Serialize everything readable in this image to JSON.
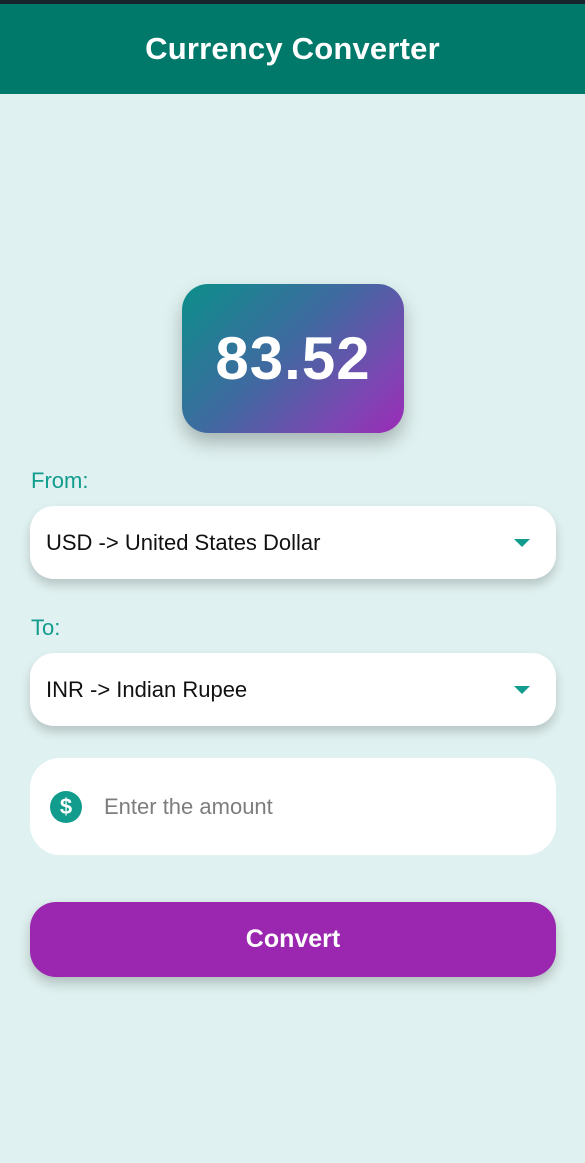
{
  "app_bar": {
    "title": "Currency Converter"
  },
  "result": {
    "value": "83.52"
  },
  "from": {
    "label": "From:",
    "selected": "USD -> United States Dollar"
  },
  "to": {
    "label": "To:",
    "selected": "INR -> Indian Rupee"
  },
  "amount": {
    "icon": "dollar-circle-icon",
    "placeholder": "Enter the amount",
    "value": ""
  },
  "convert_button": {
    "label": "Convert"
  },
  "colors": {
    "app_bar": "#00796b",
    "background": "#dff1f0",
    "accent": "#119c8d",
    "button": "#9b27b0"
  }
}
